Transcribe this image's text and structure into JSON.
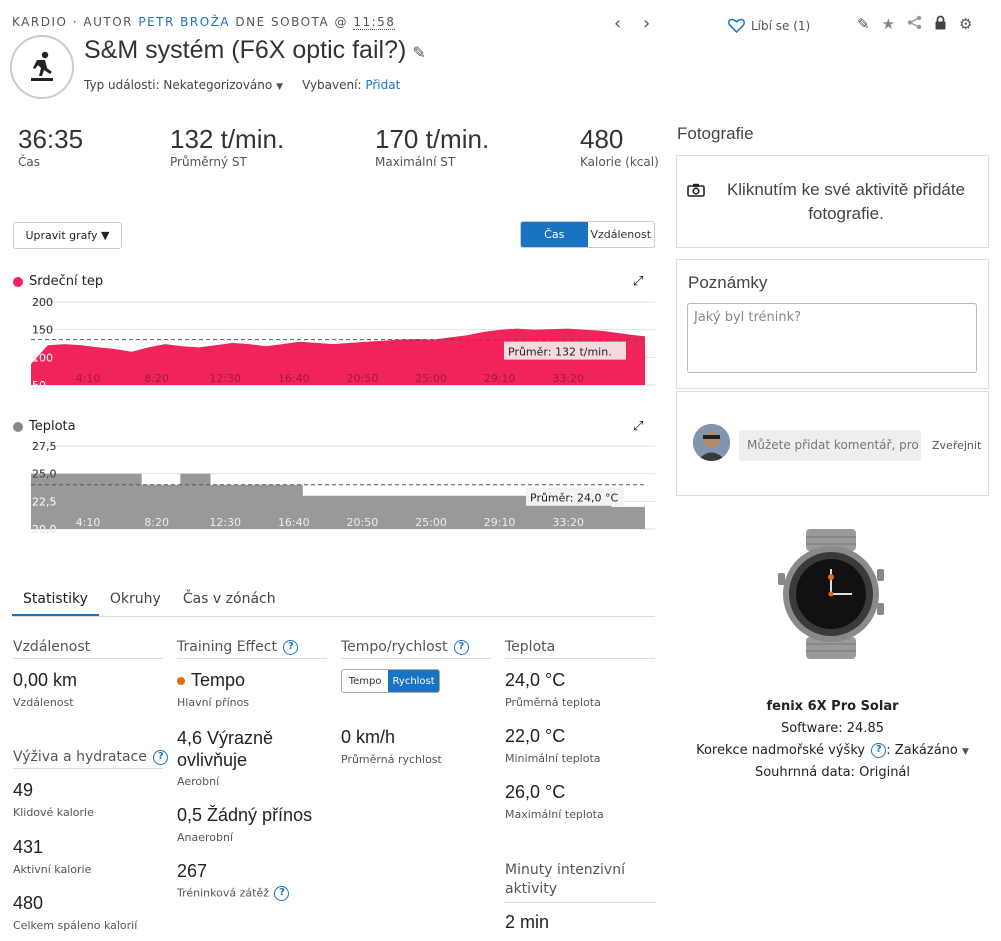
{
  "header": {
    "category": "KARDIO",
    "author_prefix": "· AUTOR",
    "author": "PETR BROŽA",
    "date_prefix": "DNE SOBOTA @",
    "time": "11:58",
    "prev_icon": "chevron-left",
    "next_icon": "chevron-right",
    "title": "S&M systém (F6X optic fail?)",
    "event_type_label": "Typ události:",
    "event_type_value": "Nekategorizováno",
    "equipment_label": "Vybavení:",
    "equipment_link": "Přidat",
    "like_label": "Líbí se (1)"
  },
  "stats": [
    {
      "value": "36:35",
      "label": "Čas"
    },
    {
      "value": "132 t/min.",
      "label": "Průměrný ST"
    },
    {
      "value": "170 t/min.",
      "label": "Maximální ST"
    },
    {
      "value": "480",
      "label": "Kalorie (kcal)"
    }
  ],
  "controls": {
    "edit_charts": "Upravit grafy ▼",
    "toggle": [
      "Čas",
      "Vzdálenost"
    ]
  },
  "charts": {
    "hr": {
      "title": "Srdeční tep",
      "color": "#f0245a",
      "y_ticks": [
        "200",
        "150",
        "100",
        "50"
      ],
      "x_ticks": [
        "4:10",
        "8:20",
        "12:30",
        "16:40",
        "20:50",
        "25:00",
        "29:10",
        "33:20"
      ],
      "avg_label": "Průměr: 132 t/min.",
      "avg": 132
    },
    "temp": {
      "title": "Teplota",
      "color": "#999999",
      "y_ticks": [
        "27,5",
        "25,0",
        "22,5",
        "20,0"
      ],
      "x_ticks": [
        "4:10",
        "8:20",
        "12:30",
        "16:40",
        "20:50",
        "25:00",
        "29:10",
        "33:20"
      ],
      "avg_label": "Průměr: 24,0 °C",
      "avg": 24.0
    }
  },
  "chart_data": [
    {
      "type": "area",
      "title": "Srdeční tep",
      "xlabel": "",
      "ylabel": "",
      "ylim": [
        50,
        200
      ],
      "x_range_min": [
        0,
        36.6
      ],
      "series": [
        {
          "name": "Srdeční tep",
          "x": [
            0,
            1,
            2,
            3,
            4,
            5,
            6,
            7,
            8,
            9,
            10,
            11,
            12,
            13,
            14,
            15,
            16,
            17,
            18,
            19,
            20,
            21,
            22,
            23,
            24,
            25,
            26,
            27,
            28,
            29,
            30,
            31,
            32,
            33,
            34,
            35,
            36,
            36.6
          ],
          "values": [
            88,
            122,
            124,
            122,
            118,
            115,
            110,
            118,
            124,
            120,
            118,
            122,
            126,
            124,
            120,
            124,
            128,
            126,
            124,
            126,
            128,
            130,
            132,
            133,
            132,
            136,
            140,
            146,
            150,
            152,
            150,
            151,
            152,
            150,
            148,
            144,
            140,
            138
          ]
        }
      ],
      "average": 132
    },
    {
      "type": "area",
      "title": "Teplota",
      "xlabel": "",
      "ylabel": "",
      "ylim": [
        20,
        27.5
      ],
      "x_range_min": [
        0,
        36.6
      ],
      "series": [
        {
          "name": "Teplota",
          "x": [
            0,
            6.6,
            6.6,
            8.9,
            8.9,
            10.7,
            10.7,
            16.2,
            16.2,
            34.6,
            34.6,
            36.6
          ],
          "values": [
            25.0,
            25.0,
            24.0,
            24.0,
            25.0,
            25.0,
            24.0,
            24.0,
            23.0,
            23.0,
            22.0,
            22.0
          ]
        }
      ],
      "average": 24.0
    }
  ],
  "tabs": [
    "Statistiky",
    "Okruhy",
    "Čas v zónách"
  ],
  "columns": {
    "distance": {
      "head": "Vzdálenost",
      "items": [
        {
          "value": "0,00 km",
          "label": "Vzdálenost"
        }
      ]
    },
    "nutrition": {
      "head": "Výživa a hydratace",
      "items": [
        {
          "value": "49",
          "label": "Klidové kalorie"
        },
        {
          "value": "431",
          "label": "Aktivní kalorie"
        },
        {
          "value": "480",
          "label": "Celkem spáleno kalorií"
        }
      ]
    },
    "training": {
      "head": "Training Effect",
      "primary_dot_color": "#e8691b",
      "items": [
        {
          "value": "Tempo",
          "label": "Hlavní přínos"
        },
        {
          "value": "4,6 Výrazně ovlivňuje",
          "label": "Aerobní"
        },
        {
          "value": "0,5 Žádný přínos",
          "label": "Anaerobní"
        },
        {
          "value": "267",
          "label": "Tréninková zátěž"
        }
      ]
    },
    "pace": {
      "head": "Tempo/rychlost",
      "toggle": [
        "Tempo",
        "Rychlost"
      ],
      "items": [
        {
          "value": "0 km/h",
          "label": "Průměrná rychlost"
        }
      ]
    },
    "temperature": {
      "head": "Teplota",
      "items": [
        {
          "value": "24,0 °C",
          "label": "Průměrná teplota"
        },
        {
          "value": "22,0 °C",
          "label": "Minimální teplota"
        },
        {
          "value": "26,0 °C",
          "label": "Maximální teplota"
        }
      ]
    },
    "intensity": {
      "head": "Minuty intenzivní aktivity",
      "items": [
        {
          "value": "2 min",
          "label": ""
        }
      ]
    }
  },
  "right": {
    "photos_title": "Fotografie",
    "photos_text": "Kliknutím ke své aktivitě přidáte fotografie.",
    "notes_title": "Poznámky",
    "notes_placeholder": "Jaký byl trénink?",
    "comment_placeholder": "Můžete přidat komentář, pro c",
    "publish": "Zveřejnit",
    "device_name": "fenix 6X Pro Solar",
    "software": "Software: 24.85",
    "altitude_label": "Korekce nadmořské výšky",
    "altitude_value": ": Zakázáno",
    "summary": "Souhrnná data: Originál"
  }
}
